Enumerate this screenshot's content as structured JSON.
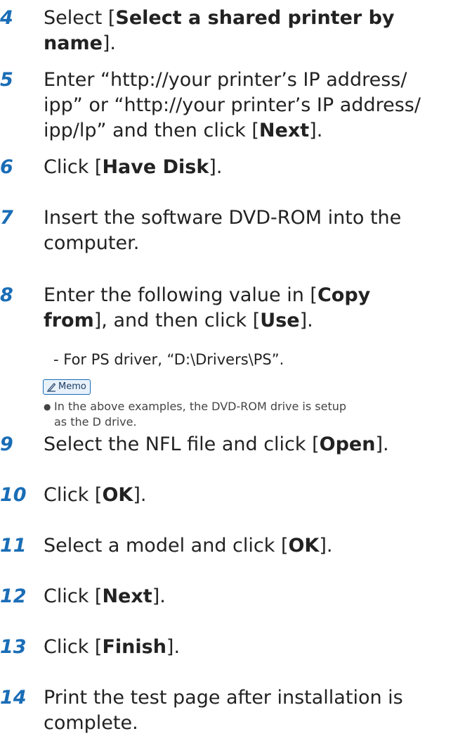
{
  "steps": [
    {
      "num": "4",
      "segments": [
        [
          {
            "t": "Select [",
            "b": false
          },
          {
            "t": "Select a shared printer by",
            "b": true
          }
        ],
        [
          {
            "t": "name",
            "b": true
          },
          {
            "t": "].",
            "b": false
          }
        ]
      ]
    },
    {
      "num": "5",
      "segments": [
        [
          {
            "t": "Enter “http://your printer’s IP address/",
            "b": false
          }
        ],
        [
          {
            "t": "ipp” or “http://your printer’s IP address/",
            "b": false
          }
        ],
        [
          {
            "t": "ipp/lp” and then click [",
            "b": false
          },
          {
            "t": "Next",
            "b": true
          },
          {
            "t": "].",
            "b": false
          }
        ]
      ]
    },
    {
      "num": "6",
      "segments": [
        [
          {
            "t": "Click [",
            "b": false
          },
          {
            "t": "Have Disk",
            "b": true
          },
          {
            "t": "].",
            "b": false
          }
        ]
      ]
    },
    {
      "num": "7",
      "segments": [
        [
          {
            "t": "Insert the software DVD-ROM into the",
            "b": false
          }
        ],
        [
          {
            "t": "computer.",
            "b": false
          }
        ]
      ]
    },
    {
      "num": "8",
      "segments": [
        [
          {
            "t": "Enter the following value in [",
            "b": false
          },
          {
            "t": "Copy",
            "b": true
          }
        ],
        [
          {
            "t": "from",
            "b": true
          },
          {
            "t": "], and then click [",
            "b": false
          },
          {
            "t": "Use",
            "b": true
          },
          {
            "t": "].",
            "b": false
          }
        ]
      ]
    },
    {
      "num": "9",
      "segments": [
        [
          {
            "t": "Select the NFL file and click [",
            "b": false
          },
          {
            "t": "Open",
            "b": true
          },
          {
            "t": "].",
            "b": false
          }
        ]
      ]
    },
    {
      "num": "10",
      "segments": [
        [
          {
            "t": "Click [",
            "b": false
          },
          {
            "t": "OK",
            "b": true
          },
          {
            "t": "].",
            "b": false
          }
        ]
      ]
    },
    {
      "num": "11",
      "segments": [
        [
          {
            "t": "Select a model and click [",
            "b": false
          },
          {
            "t": "OK",
            "b": true
          },
          {
            "t": "].",
            "b": false
          }
        ]
      ]
    },
    {
      "num": "12",
      "segments": [
        [
          {
            "t": "Click [",
            "b": false
          },
          {
            "t": "Next",
            "b": true
          },
          {
            "t": "].",
            "b": false
          }
        ]
      ]
    },
    {
      "num": "13",
      "segments": [
        [
          {
            "t": "Click [",
            "b": false
          },
          {
            "t": "Finish",
            "b": true
          },
          {
            "t": "].",
            "b": false
          }
        ]
      ]
    },
    {
      "num": "14",
      "segments": [
        [
          {
            "t": "Print the test page after installation is",
            "b": false
          }
        ],
        [
          {
            "t": "complete.",
            "b": false
          }
        ]
      ]
    }
  ],
  "step8_sub": "- For PS driver, “D:\\Drivers\\PS”.",
  "memo": {
    "label": "Memo",
    "icon": "memo-pencil-icon",
    "bullet": "●",
    "note_line1": "In the above examples, the DVD-ROM drive is setup",
    "note_line2": "as the D drive."
  },
  "colors": {
    "accent": "#1a6db6",
    "text": "#222222"
  }
}
